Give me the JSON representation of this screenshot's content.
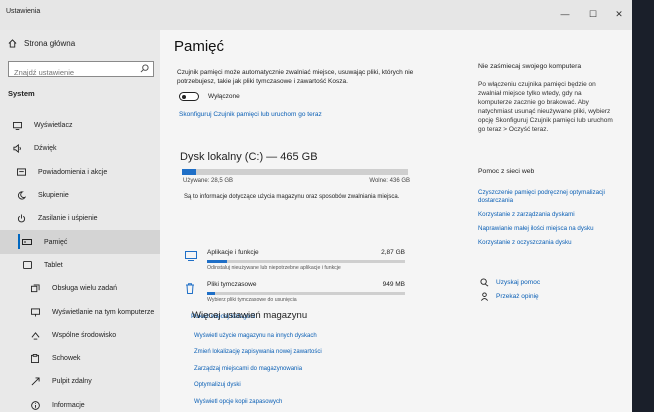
{
  "window": {
    "title": "Ustawienia",
    "minimize": "—",
    "maximize": "☐",
    "close": "✕"
  },
  "sidebar": {
    "home": "Strona główna",
    "search_placeholder": "Znajdź ustawienie",
    "section": "System",
    "items": [
      {
        "label": "Wyświetlacz",
        "icon": "monitor-icon"
      },
      {
        "label": "Dźwięk",
        "icon": "speaker-icon"
      },
      {
        "label": "Powiadomienia i akcje",
        "icon": "notification-icon"
      },
      {
        "label": "Skupienie",
        "icon": "moon-icon"
      },
      {
        "label": "Zasilanie i uśpienie",
        "icon": "power-icon"
      },
      {
        "label": "Pamięć",
        "icon": "storage-icon",
        "active": true
      },
      {
        "label": "Tablet",
        "icon": "tablet-icon"
      },
      {
        "label": "Obsługa wielu zadań",
        "icon": "multitask-icon"
      },
      {
        "label": "Wyświetlanie na tym komputerze",
        "icon": "project-icon"
      },
      {
        "label": "Wspólne środowisko",
        "icon": "share-icon"
      },
      {
        "label": "Schowek",
        "icon": "clipboard-icon"
      },
      {
        "label": "Pulpit zdalny",
        "icon": "remote-icon"
      },
      {
        "label": "Informacje",
        "icon": "info-icon"
      }
    ]
  },
  "main": {
    "title": "Pamięć",
    "description": "Czujnik pamięci może automatycznie zwalniać miejsce, usuwając pliki, których nie potrzebujesz, takie jak pliki tymczasowe i zawartość Kosza.",
    "toggle_label": "Wyłączone",
    "toggle_on": false,
    "configure_link": "Skonfiguruj Czujnik pamięci lub uruchom go teraz",
    "disk": {
      "title": "Dysk lokalny (C:) — 465 GB",
      "used_label": "Używane: 28,5 GB",
      "free_label": "Wolne: 436 GB",
      "used_fraction": 0.061
    },
    "info": "Są to informacje dotyczące użycia magazynu oraz sposobów zwalniania miejsca.",
    "categories": [
      {
        "name": "Aplikacje i funkcje",
        "size": "2,87 GB",
        "desc": "Odinstaluj nieużywane lub niepotrzebne aplikacje i funkcje",
        "fraction": 0.1,
        "icon": "apps-icon"
      },
      {
        "name": "Pliki tymczasowe",
        "size": "949 MB",
        "desc": "Wybierz pliki tymczasowe do usunięcia",
        "fraction": 0.04,
        "icon": "trash-icon"
      }
    ],
    "more_categories": "Pokaż więcej kategorii",
    "more_settings_title": "Więcej ustawień magazynu",
    "more_settings_links": [
      "Wyświetl użycie magazynu na innych dyskach",
      "Zmień lokalizację zapisywania nowej zawartości",
      "Zarządzaj miejscami do magazynowania",
      "Optymalizuj dyski",
      "Wyświetl opcje kopii zapasowych"
    ]
  },
  "right": {
    "heading": "Nie zaśmiecaj swojego komputera",
    "text": "Po włączeniu czujnika pamięci będzie on zwalniał miejsce tylko wtedy, gdy na komputerze zacznie go brakować. Aby natychmiast usunąć nieużywane pliki, wybierz opcję Skonfiguruj Czujnik pamięci lub uruchom go teraz > Oczyść teraz.",
    "help_heading": "Pomoc z sieci web",
    "help_links": [
      "Czyszczenie pamięci podręcznej optymalizacji dostarczania",
      "Korzystanie z zarządzania dyskami",
      "Naprawianie małej ilości miejsca na dysku",
      "Korzystanie z oczyszczania dysku"
    ],
    "get_help": "Uzyskaj pomoc",
    "feedback": "Przekaż opinię"
  }
}
